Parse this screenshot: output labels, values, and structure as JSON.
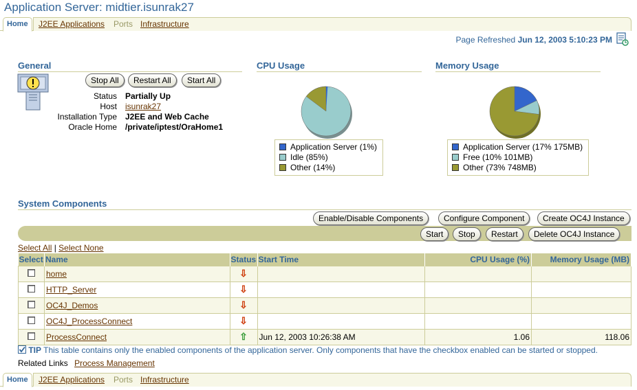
{
  "title": "Application Server: midtier.isunrak27",
  "tabs": {
    "home": "Home",
    "j2ee": "J2EE Applications",
    "ports": "Ports",
    "infra": "Infrastructure"
  },
  "refresh": {
    "label": "Page Refreshed",
    "timestamp": "Jun 12, 2003 5:10:23 PM"
  },
  "general": {
    "heading": "General",
    "buttons": {
      "stop": "Stop All",
      "restart": "Restart All",
      "start": "Start All"
    },
    "status_label": "Status",
    "status_value": "Partially Up",
    "host_label": "Host",
    "host_value": "isunrak27",
    "install_label": "Installation Type",
    "install_value": "J2EE and Web Cache",
    "home_label": "Oracle Home",
    "home_value": "/private/iptest/OraHome1"
  },
  "cpu": {
    "heading": "CPU Usage",
    "legend": [
      "Application Server (1%)",
      "Idle (85%)",
      "Other (14%)"
    ],
    "colors": [
      "#3366cc",
      "#99cccc",
      "#999933"
    ]
  },
  "memory": {
    "heading": "Memory Usage",
    "legend": [
      "Application Server (17% 175MB)",
      "Free (10% 101MB)",
      "Other (73% 748MB)"
    ],
    "colors": [
      "#3366cc",
      "#99cccc",
      "#999933"
    ]
  },
  "components": {
    "heading": "System Components",
    "buttons": {
      "enable": "Enable/Disable Components",
      "configure": "Configure Component",
      "create": "Create OC4J Instance",
      "start": "Start",
      "stop": "Stop",
      "restart": "Restart",
      "delete": "Delete OC4J Instance"
    },
    "select_all": "Select All",
    "separator": "|",
    "select_none": "Select None",
    "columns": [
      "Select",
      "Name",
      "Status",
      "Start Time",
      "CPU Usage (%)",
      "Memory Usage (MB)"
    ],
    "rows": [
      {
        "name": "home",
        "status": "down",
        "start": "",
        "cpu": "",
        "mem": ""
      },
      {
        "name": "HTTP_Server",
        "status": "down",
        "start": "",
        "cpu": "",
        "mem": ""
      },
      {
        "name": "OC4J_Demos",
        "status": "down",
        "start": "",
        "cpu": "",
        "mem": ""
      },
      {
        "name": "OC4J_ProcessConnect",
        "status": "down",
        "start": "",
        "cpu": "",
        "mem": ""
      },
      {
        "name": "ProcessConnect",
        "status": "up",
        "start": "Jun 12, 2003 10:26:38 AM",
        "cpu": "1.06",
        "mem": "118.06"
      }
    ]
  },
  "tip": {
    "label": "TIP",
    "text": "This table contains only the enabled components of the application server. Only components that have the checkbox enabled can be started or stopped."
  },
  "related": {
    "label": "Related Links",
    "link": "Process Management"
  }
}
